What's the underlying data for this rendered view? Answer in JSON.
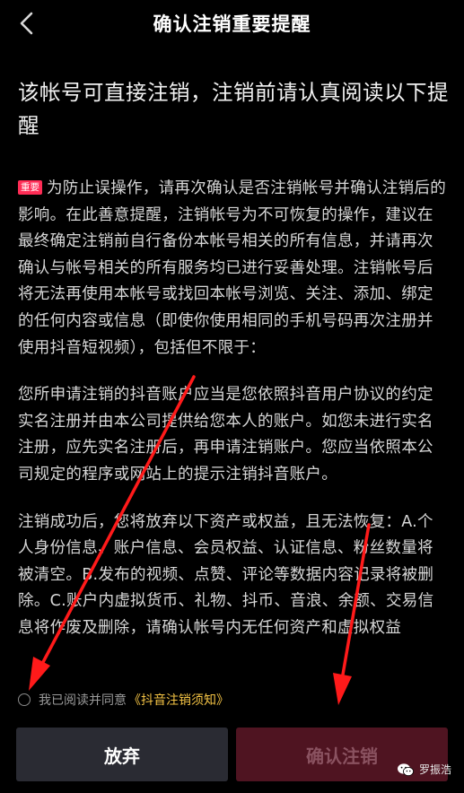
{
  "header": {
    "back_icon": "chevron-left-icon",
    "title": "确认注销重要提醒"
  },
  "heading": "该帐号可直接注销，注销前请认真阅读以下提醒",
  "content": {
    "badge": "重要",
    "paragraphs": [
      "为防止误操作，请再次确认是否注销帐号并确认注销后的影响。在此善意提醒，注销帐号为不可恢复的操作，建议在最终确定注销前自行备份本帐号相关的所有信息，并请再次确认与帐号相关的所有服务均已进行妥善处理。注销帐号后将无法再使用本帐号或找回本帐号浏览、关注、添加、绑定的任何内容或信息（即使你使用相同的手机号码再次注册并使用抖音短视频），包括但不限于：",
      "您所申请注销的抖音账户应当是您依照抖音用户协议的约定实名注册并由本公司提供给您本人的账户。如您未进行实名注册，应先实名注册后，再申请注销账户。您应当依照本公司规定的程序或网站上的提示注销抖音账户。",
      "注销成功后，您将放弃以下资产或权益，且无法恢复：A.个人身份信息、账户信息、会员权益、认证信息、粉丝数量将被清空。B.发布的视频、点赞、评论等数据内容记录将被删除。C.账户内虚拟货币、礼物、抖币、音浪、余额、交易信息将作废及删除，请确认帐号内无任何资产和虚拟权益"
    ]
  },
  "agreement": {
    "text": "我已阅读并同意",
    "link": "《抖音注销须知》"
  },
  "buttons": {
    "abandon": "放弃",
    "confirm": "确认注销"
  },
  "watermark": {
    "icon": "wechat-icon",
    "text": "罗振浩"
  },
  "colors": {
    "background": "#000000",
    "accent": "#fe2c55",
    "link": "#f5c445",
    "annotation_arrow": "#ff1a1a"
  }
}
